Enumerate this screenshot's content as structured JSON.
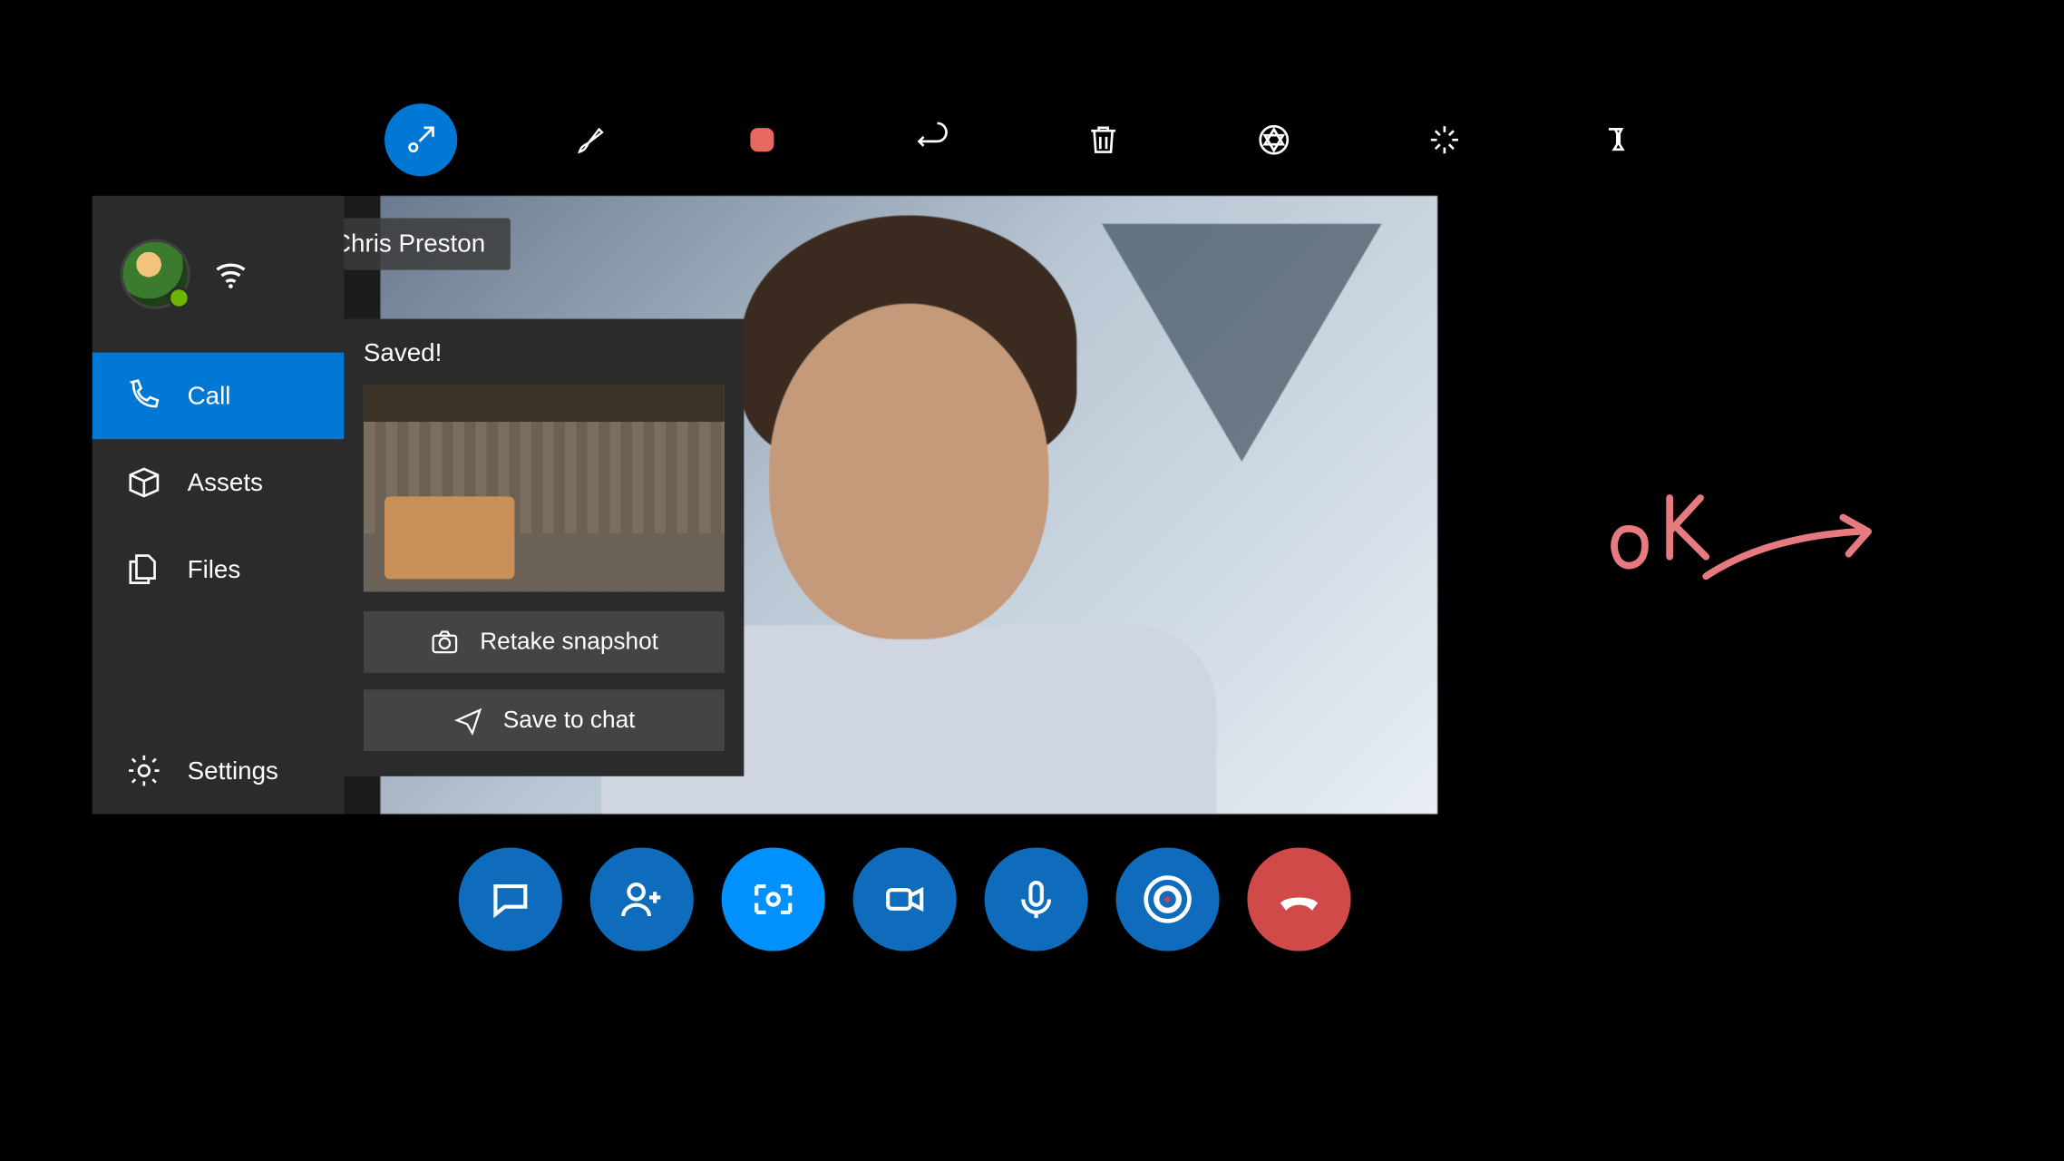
{
  "toolbar": {
    "items": [
      {
        "name": "collapse-icon",
        "active": true
      },
      {
        "name": "pen-icon"
      },
      {
        "name": "stop-icon"
      },
      {
        "name": "undo-icon"
      },
      {
        "name": "trash-icon"
      },
      {
        "name": "aperture-icon"
      },
      {
        "name": "expand-icon"
      },
      {
        "name": "pin-icon"
      }
    ]
  },
  "remote": {
    "name": "Chris Preston"
  },
  "sidebar": {
    "items": [
      {
        "id": "call",
        "label": "Call",
        "active": true
      },
      {
        "id": "assets",
        "label": "Assets",
        "active": false
      },
      {
        "id": "files",
        "label": "Files",
        "active": false
      }
    ],
    "settings_label": "Settings"
  },
  "snapshot": {
    "status": "Saved!",
    "retake_label": "Retake snapshot",
    "save_label": "Save to chat"
  },
  "controls": [
    {
      "name": "chat-button"
    },
    {
      "name": "add-person-button"
    },
    {
      "name": "snapshot-button",
      "active": true
    },
    {
      "name": "video-button"
    },
    {
      "name": "mic-button"
    },
    {
      "name": "record-button"
    },
    {
      "name": "hangup-button"
    }
  ],
  "ink_annotation": "OK"
}
